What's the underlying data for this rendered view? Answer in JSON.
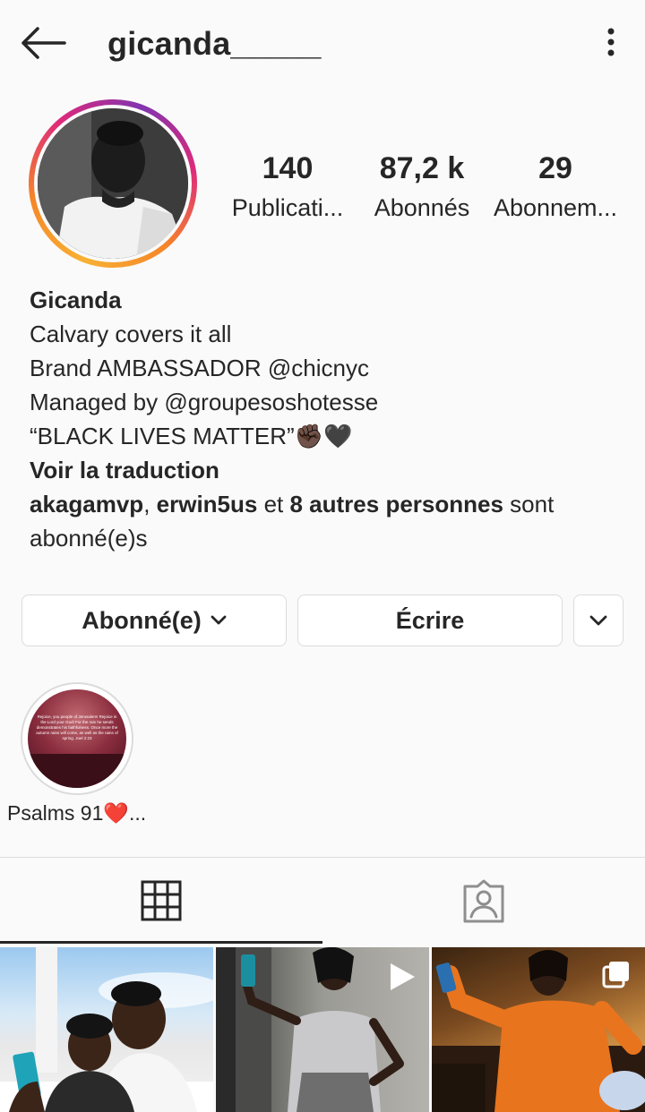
{
  "header": {
    "username": "gicanda_____"
  },
  "stats": {
    "posts": {
      "value": "140",
      "label": "Publicati..."
    },
    "followers": {
      "value": "87,2 k",
      "label": "Abonnés"
    },
    "following": {
      "value": "29",
      "label": "Abonnem..."
    }
  },
  "bio": {
    "name": "Gicanda",
    "lines": [
      "Calvary covers it all",
      "Brand AMBASSADOR @chicnyc",
      "Managed by @groupesoshotesse",
      "“BLACK LIVES MATTER”"
    ],
    "emoji": "✊🏿🖤",
    "translate": "Voir la traduction",
    "followed_by": {
      "user1": "akagamvp",
      "sep": ", ",
      "user2": "erwin5us",
      "and": " et ",
      "others": "8 autres personnes",
      "suffix": " sont abonné(e)s"
    }
  },
  "buttons": {
    "follow": "Abonné(e)",
    "message": "Écrire"
  },
  "highlights": [
    {
      "label": "Psalms 91❤️...",
      "text": "Rejoice, you people of Jerusalem! Rejoice in the Lord your God! For the rain he sends demonstrates his faithfulness. Once more the autumn rains will come, as well as the rains of spring. Joel 2:23"
    }
  ],
  "colors": {
    "text": "#262626",
    "border": "#dbdbdb",
    "background": "#fafafa"
  },
  "icons": {
    "back": "arrow-left",
    "more": "vertical-ellipsis",
    "grid": "grid",
    "tagged": "person-tag"
  }
}
